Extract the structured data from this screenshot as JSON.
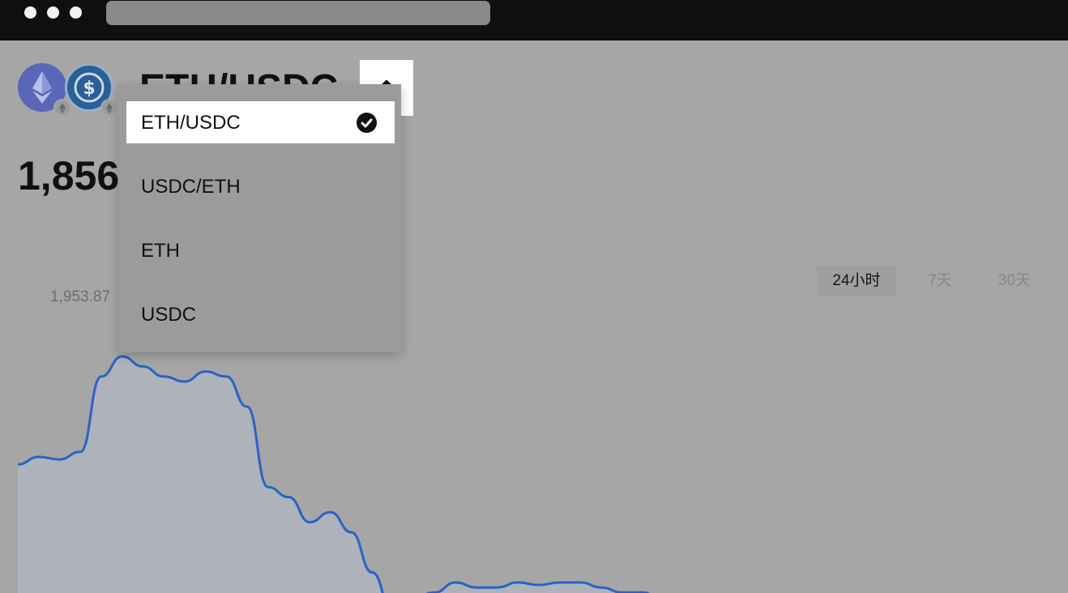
{
  "window": {
    "traffic_lights": [
      "dot",
      "dot",
      "dot"
    ],
    "address_bar_text": ""
  },
  "header": {
    "base_token_icon": "eth-icon",
    "quote_token_icon": "usdc-icon",
    "chain_badge_icon": "ethereum-chain-icon",
    "pair": "ETH/USDC",
    "toggle_icon": "chevron-up-icon"
  },
  "price": {
    "value": "1,856"
  },
  "pair_menu": {
    "items": [
      {
        "label": "ETH/USDC",
        "selected": true
      },
      {
        "label": "USDC/ETH",
        "selected": false
      },
      {
        "label": "ETH",
        "selected": false
      },
      {
        "label": "USDC",
        "selected": false
      }
    ],
    "selected_icon": "check-circle-icon"
  },
  "range_tabs": [
    {
      "label": "24小时",
      "active": true
    },
    {
      "label": "7天",
      "active": false
    },
    {
      "label": "30天",
      "active": false
    }
  ],
  "chart": {
    "max_label": "1,953.87",
    "line_color": "#2a62c6",
    "fill_color": "#aeb2ba"
  },
  "chart_data": {
    "type": "area",
    "title": "",
    "xlabel": "",
    "ylabel": "",
    "annotations": [
      "1,953.87"
    ],
    "series": [
      {
        "values": [
          1911,
          1914,
          1913,
          1916,
          1946,
          1954,
          1950,
          1946,
          1944,
          1948,
          1946,
          1934,
          1902,
          1898,
          1888,
          1892,
          1884,
          1868,
          1852,
          1858,
          1860,
          1864,
          1862,
          1862,
          1864,
          1863,
          1864,
          1864,
          1862,
          1860,
          1860,
          1856,
          1854
        ]
      }
    ]
  }
}
